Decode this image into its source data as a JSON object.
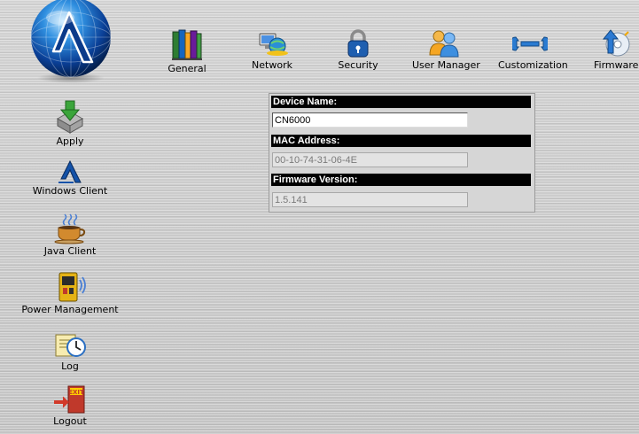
{
  "topnav": {
    "items": [
      {
        "label": "General",
        "icon": "books-icon"
      },
      {
        "label": "Network",
        "icon": "network-globe-icon"
      },
      {
        "label": "Security",
        "icon": "padlock-icon"
      },
      {
        "label": "User Manager",
        "icon": "users-icon"
      },
      {
        "label": "Customization",
        "icon": "wrench-icon"
      },
      {
        "label": "Firmware",
        "icon": "firmware-upgrade-icon"
      }
    ]
  },
  "sidebar": {
    "items": [
      {
        "label": "Apply",
        "icon": "download-apply-icon"
      },
      {
        "label": "Windows Client",
        "icon": "windows-client-logo-icon"
      },
      {
        "label": "Java Client",
        "icon": "coffee-cup-icon"
      },
      {
        "label": "Power Management",
        "icon": "power-device-icon"
      },
      {
        "label": "Log",
        "icon": "log-clock-icon"
      },
      {
        "label": "Logout",
        "icon": "exit-door-icon"
      }
    ]
  },
  "form": {
    "device_name_label": "Device Name:",
    "device_name_value": "CN6000",
    "mac_address_label": "MAC Address:",
    "mac_address_value": "00-10-74-31-06-4E",
    "firmware_version_label": "Firmware Version:",
    "firmware_version_value": "1.5.141"
  },
  "colors": {
    "section_header_bg": "#000000",
    "section_header_text": "#ffffff",
    "readonly_text": "#7a7a7a"
  }
}
